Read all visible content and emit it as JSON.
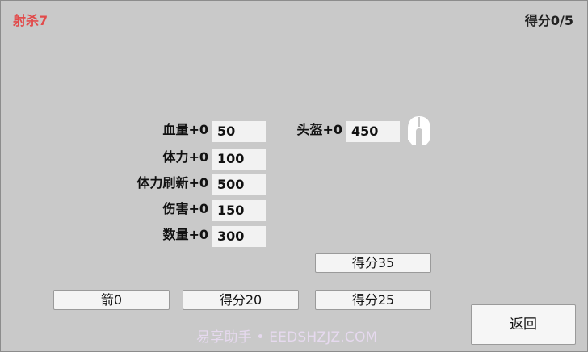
{
  "hud": {
    "kills": "射杀7",
    "score": "得分0/5"
  },
  "stats": [
    {
      "label": "血量+0",
      "value": "50"
    },
    {
      "label": "体力+0",
      "value": "100"
    },
    {
      "label": "体力刷新+0",
      "value": "500"
    },
    {
      "label": "伤害+0",
      "value": "150"
    },
    {
      "label": "数量+0",
      "value": "300"
    }
  ],
  "helmet": {
    "label": "头盔+0",
    "value": "450",
    "icon": "spartan-helmet-icon"
  },
  "buttons": {
    "score35": "得分35",
    "arrows": "箭0",
    "score20": "得分20",
    "score25": "得分25",
    "back": "返回"
  },
  "watermark": "易享助手 • EEDSHZJZ.COM"
}
